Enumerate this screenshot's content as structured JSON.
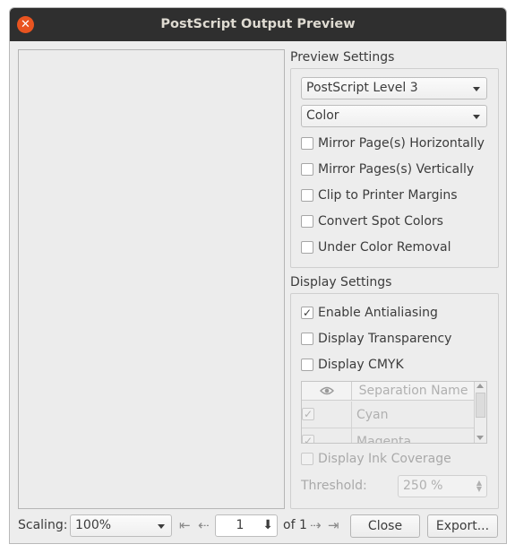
{
  "window": {
    "title": "PostScript Output Preview"
  },
  "preview_settings": {
    "title": "Preview Settings",
    "level_select": "PostScript Level 3",
    "color_select": "Color",
    "options": [
      {
        "label": "Mirror Page(s) Horizontally",
        "checked": false
      },
      {
        "label": "Mirror Pages(s) Vertically",
        "checked": false
      },
      {
        "label": "Clip to Printer Margins",
        "checked": false
      },
      {
        "label": "Convert Spot Colors",
        "checked": false
      },
      {
        "label": "Under Color Removal",
        "checked": false
      }
    ]
  },
  "display_settings": {
    "title": "Display Settings",
    "options": [
      {
        "label": "Enable Antialiasing",
        "checked": true
      },
      {
        "label": "Display Transparency",
        "checked": false
      },
      {
        "label": "Display CMYK",
        "checked": false
      }
    ],
    "separations": {
      "header_icon": "eye-icon",
      "header_name": "Separation Name",
      "rows": [
        {
          "name": "Cyan",
          "checked": true
        },
        {
          "name": "Magenta",
          "checked": true
        }
      ]
    },
    "ink_coverage": {
      "label": "Display Ink Coverage",
      "checked": false
    },
    "threshold": {
      "label": "Threshold:",
      "value": "250 %"
    }
  },
  "footer": {
    "scaling_label": "Scaling:",
    "scaling_value": "100%",
    "page_value": "1",
    "of_label": "of 1",
    "close_label": "Close",
    "export_label": "Export..."
  }
}
